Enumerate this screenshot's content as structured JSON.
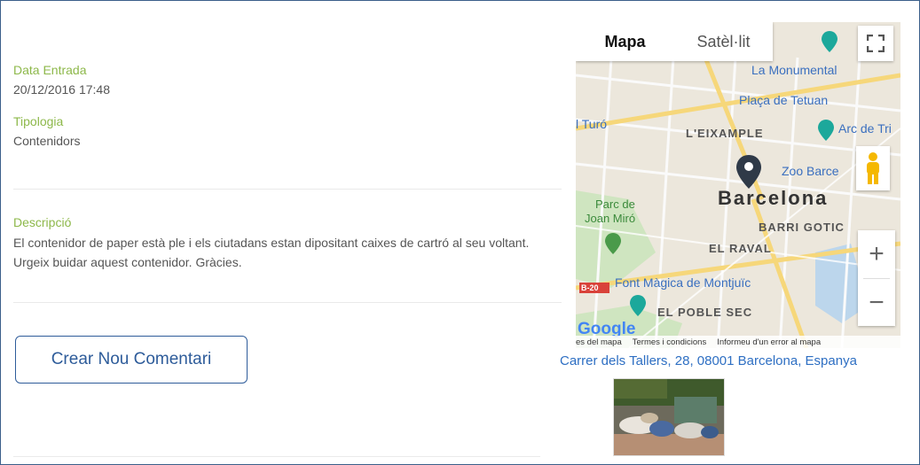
{
  "details": {
    "entry_date": {
      "label": "Data Entrada",
      "value": "20/12/2016 17:48"
    },
    "type": {
      "label": "Tipologia",
      "value": "Contenidors"
    },
    "description": {
      "label": "Descripció",
      "value": "El contenidor de paper està ple i els ciutadans estan dipositant caixes de cartró al seu voltant. Urgeix buidar aquest contenidor. Gràcies."
    }
  },
  "actions": {
    "new_comment": "Crear Nou Comentari"
  },
  "map": {
    "tabs": {
      "map": "Mapa",
      "satellite": "Satèl·lit"
    },
    "zoom_in": "+",
    "zoom_out": "−",
    "labels": {
      "monumental": "La Monumental",
      "tetuan": "Plaça de Tetuan",
      "turo": "l Turó",
      "arc": "Arc de Tri",
      "eixample": "L'EIXAMPLE",
      "zoo": "Zoo Barce",
      "city": "Barcelona",
      "parc1": "Parc de",
      "parc2": "Joan Miró",
      "gotic": "BARRI GOTIC",
      "raval": "EL RAVAL",
      "font": "Font Màgica de Montjuïc",
      "poblesec": "EL POBLE SEC",
      "highway": "B-20"
    },
    "attribution": [
      "es del mapa",
      "Termes i condicions",
      "Informeu d'un error al mapa"
    ],
    "google": "Google"
  },
  "address": "Carrer dels Tallers, 28, 08001 Barcelona, Espanya",
  "colors": {
    "label_green": "#8db84a",
    "link_blue": "#2e6fc3",
    "button_blue": "#2e5c9a"
  }
}
